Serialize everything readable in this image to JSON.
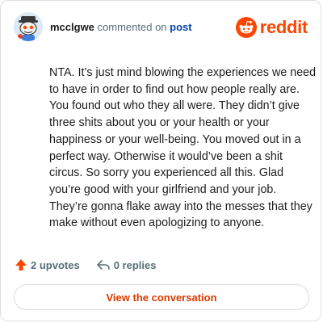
{
  "header": {
    "username": "mcclgwe",
    "action_text": "commented on",
    "post_link_label": "post",
    "brand_name": "reddit"
  },
  "comment": {
    "text": "NTA. It’s just mind blowing the experiences we need to have in order to find out how people really are. You found out who they all were. They didn’t give three shits about you or your health or your happiness or your well-being. You moved out in a perfect way. Otherwise it would’ve been a shit circus. So sorry you experienced all this. Glad you’re good with your girlfriend and your job. They’re gonna flake away into the messes that they make without even apologizing to anyone."
  },
  "actions": {
    "upvotes_label": "2 upvotes",
    "replies_label": "0 replies"
  },
  "cta": {
    "label": "View the conversation"
  },
  "colors": {
    "brand": "#ff4500",
    "link": "#0045ac",
    "cta_text": "#d93900",
    "muted": "#576f76"
  },
  "icons": {
    "avatar": "snoo-avatar",
    "brand_logo": "reddit-logo-icon",
    "upvote": "upvote-arrow-icon",
    "reply": "reply-arrow-icon"
  }
}
